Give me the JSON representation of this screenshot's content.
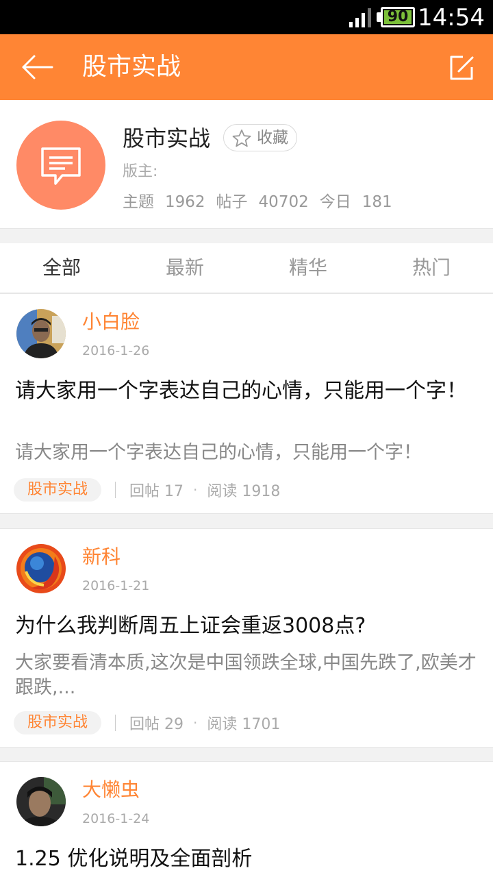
{
  "statusbar": {
    "battery": "90",
    "time": "14:54"
  },
  "header": {
    "title": "股市实战",
    "back_icon": "back-arrow-icon",
    "compose_icon": "compose-icon"
  },
  "forum": {
    "name": "股市实战",
    "favorite_label": "收藏",
    "moderator_label": "版主:",
    "stats": {
      "topics_label": "主题",
      "topics": "1962",
      "posts_label": "帖子",
      "posts": "40702",
      "today_label": "今日",
      "today": "181"
    }
  },
  "tabs": [
    {
      "label": "全部",
      "active": true
    },
    {
      "label": "最新",
      "active": false
    },
    {
      "label": "精华",
      "active": false
    },
    {
      "label": "热门",
      "active": false
    }
  ],
  "posts": [
    {
      "author": "小白脸",
      "date": "2016-1-26",
      "title": "请大家用一个字表达自己的心情，只能用一个字！",
      "excerpt": "请大家用一个字表达自己的心情，只能用一个字！",
      "tag": "股市实战",
      "replies": "回帖 17",
      "reads": "阅读 1918"
    },
    {
      "author": "新科",
      "date": "2016-1-21",
      "title": "为什么我判断周五上证会重返3008点?",
      "excerpt": "大家要看清本质,这次是中国领跌全球,中国先跌了,欧美才跟跌,...",
      "tag": "股市实战",
      "replies": "回帖 29",
      "reads": "阅读 1701"
    },
    {
      "author": "大懒虫",
      "date": "2016-1-24",
      "title": "1.25 优化说明及全面剖析"
    }
  ],
  "colors": {
    "accent": "#ff8534",
    "forum_avatar": "#ff8a66"
  }
}
